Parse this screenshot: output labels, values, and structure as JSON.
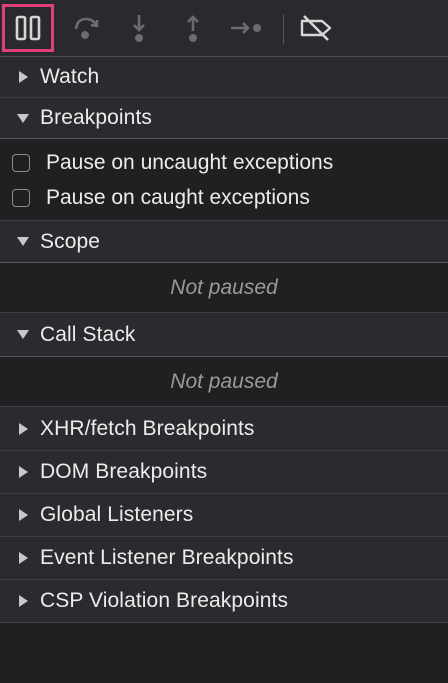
{
  "toolbar": {
    "buttons": [
      {
        "name": "pause-icon",
        "active": true
      },
      {
        "name": "step-over-icon",
        "active": false
      },
      {
        "name": "step-into-icon",
        "active": false
      },
      {
        "name": "step-out-icon",
        "active": false
      },
      {
        "name": "step-icon",
        "active": false
      },
      {
        "name": "deactivate-breakpoints-icon",
        "active": false
      }
    ],
    "active_highlight_color": "#e0407a"
  },
  "sections": {
    "watch": {
      "title": "Watch",
      "expanded": false
    },
    "breakpoints": {
      "title": "Breakpoints",
      "expanded": true,
      "options": [
        {
          "label": "Pause on uncaught exceptions",
          "checked": false
        },
        {
          "label": "Pause on caught exceptions",
          "checked": false
        }
      ]
    },
    "scope": {
      "title": "Scope",
      "expanded": true,
      "empty_text": "Not paused"
    },
    "call_stack": {
      "title": "Call Stack",
      "expanded": true,
      "empty_text": "Not paused"
    },
    "xhr": {
      "title": "XHR/fetch Breakpoints",
      "expanded": false
    },
    "dom": {
      "title": "DOM Breakpoints",
      "expanded": false
    },
    "global": {
      "title": "Global Listeners",
      "expanded": false
    },
    "event": {
      "title": "Event Listener Breakpoints",
      "expanded": false
    },
    "csp": {
      "title": "CSP Violation Breakpoints",
      "expanded": false
    }
  }
}
